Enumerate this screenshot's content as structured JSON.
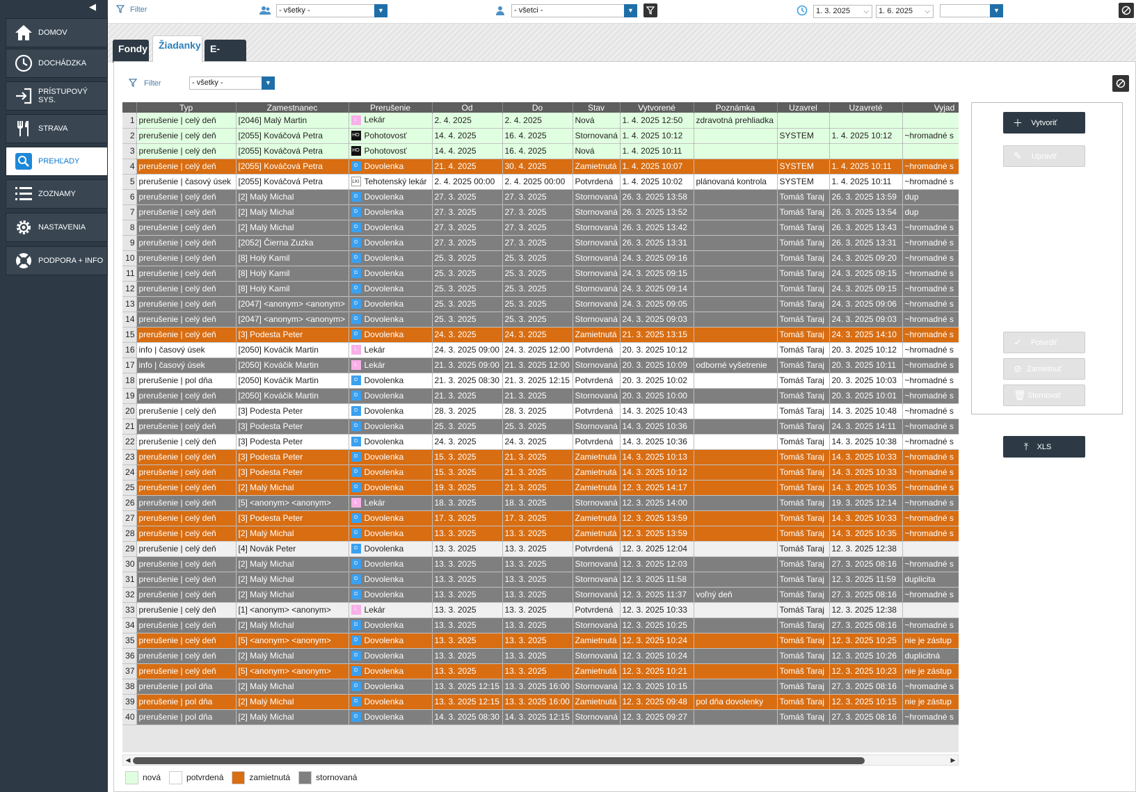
{
  "sidebar": {
    "items": [
      {
        "label": "DOMOV",
        "icon": "home-icon"
      },
      {
        "label": "DOCHÁDZKA",
        "icon": "clock-icon"
      },
      {
        "label": "PRÍSTUPOVÝ SYS.",
        "icon": "login-icon"
      },
      {
        "label": "STRAVA",
        "icon": "cutlery-icon"
      },
      {
        "label": "PREHĽADY",
        "icon": "search-icon",
        "active": true
      },
      {
        "label": "ZOZNAMY",
        "icon": "list-icon"
      },
      {
        "label": "NASTAVENIA",
        "icon": "gear-icon"
      },
      {
        "label": "PODPORA + INFO",
        "icon": "lifebuoy-icon"
      }
    ]
  },
  "topbar": {
    "filter_label": "Filter",
    "group_value": "- všetky -",
    "person_value": "- všetci -",
    "date_from": "1. 3. 2025",
    "date_to": "1. 6. 2025",
    "period_value": ""
  },
  "tabs": [
    {
      "label": "Fondy"
    },
    {
      "label": "Žiadanky",
      "active": true
    },
    {
      "label": "E-maily"
    }
  ],
  "content": {
    "filter_label": "Filter",
    "filter_value": "- všetky -"
  },
  "grid": {
    "columns": [
      "Typ",
      "Zamestnanec",
      "Prerušenie",
      "Od",
      "Do",
      "Stav",
      "Vytvorené",
      "Poznámka",
      "Uzavrel",
      "Uzavreté",
      "Vyjad"
    ],
    "rows": [
      [
        "nova",
        "prerušenie | celý deň",
        "[2046] Malý Martin",
        "L",
        "Lekár",
        "2. 4. 2025",
        "2. 4. 2025",
        "Nová",
        "1. 4. 2025  12:50",
        "zdravotná prehliadka",
        "",
        "",
        " "
      ],
      [
        "nova",
        "prerušenie | celý deň",
        "[2055] Kováčová Petra",
        "HO",
        "Pohotovosť",
        "14. 4. 2025",
        "16. 4. 2025",
        "Stornovaná",
        "1. 4. 2025  10:12",
        "",
        "SYSTEM",
        "1. 4. 2025  10:12",
        "~hromadné s"
      ],
      [
        "nova",
        "prerušenie | celý deň",
        "[2055] Kováčová Petra",
        "HO",
        "Pohotovosť",
        "14. 4. 2025",
        "16. 4. 2025",
        "Nová",
        "1. 4. 2025  10:11",
        "",
        "",
        "",
        ""
      ],
      [
        "zamietnuta",
        "prerušenie | celý deň",
        "[2055] Kováčová Petra",
        "D",
        "Dovolenka",
        "21. 4. 2025",
        "30. 4. 2025",
        "Zamietnutá",
        "1. 4. 2025  10:07",
        "",
        "SYSTEM",
        "1. 4. 2025  10:11",
        "~hromadné s"
      ],
      [
        "potvrdena",
        "prerušenie | časový úsek",
        "[2055] Kováčová Petra",
        "LKI",
        "Tehotenský lekár",
        "2. 4. 2025 00:00",
        "2. 4. 2025 00:00",
        "Potvrdená",
        "1. 4. 2025  10:02",
        "plánovaná kontrola",
        "SYSTEM",
        "1. 4. 2025  10:11",
        "~hromadné s"
      ],
      [
        "stornovana",
        "prerušenie | celý deň",
        "[2] Malý Michal",
        "D",
        "Dovolenka",
        "27. 3. 2025",
        "27. 3. 2025",
        "Stornovaná",
        "26. 3. 2025  13:58",
        "",
        "Tomáš Taraj",
        "26. 3. 2025  13:59",
        "dup"
      ],
      [
        "stornovana",
        "prerušenie | celý deň",
        "[2] Malý Michal",
        "D",
        "Dovolenka",
        "27. 3. 2025",
        "27. 3. 2025",
        "Stornovaná",
        "26. 3. 2025  13:52",
        "",
        "Tomáš Taraj",
        "26. 3. 2025  13:54",
        "dup"
      ],
      [
        "stornovana",
        "prerušenie | celý deň",
        "[2] Malý Michal",
        "D",
        "Dovolenka",
        "27. 3. 2025",
        "27. 3. 2025",
        "Stornovaná",
        "26. 3. 2025  13:42",
        "",
        "Tomáš Taraj",
        "26. 3. 2025  13:43",
        "~hromadné s"
      ],
      [
        "stornovana",
        "prerušenie | celý deň",
        "[2052] Čierna Zuzka",
        "D",
        "Dovolenka",
        "27. 3. 2025",
        "27. 3. 2025",
        "Stornovaná",
        "26. 3. 2025  13:31",
        "",
        "Tomáš Taraj",
        "26. 3. 2025  13:31",
        "~hromadné s"
      ],
      [
        "stornovana",
        "prerušenie | celý deň",
        "[8] Holý Kamil",
        "D",
        "Dovolenka",
        "25. 3. 2025",
        "25. 3. 2025",
        "Stornovaná",
        "24. 3. 2025  09:16",
        "",
        "Tomáš Taraj",
        "24. 3. 2025  09:20",
        "~hromadné s"
      ],
      [
        "stornovana",
        "prerušenie | celý deň",
        "[8] Holý Kamil",
        "D",
        "Dovolenka",
        "25. 3. 2025",
        "25. 3. 2025",
        "Stornovaná",
        "24. 3. 2025  09:15",
        "",
        "Tomáš Taraj",
        "24. 3. 2025  09:15",
        "~hromadné s"
      ],
      [
        "stornovana",
        "prerušenie | celý deň",
        "[8] Holý Kamil",
        "D",
        "Dovolenka",
        "25. 3. 2025",
        "25. 3. 2025",
        "Stornovaná",
        "24. 3. 2025  09:14",
        "",
        "Tomáš Taraj",
        "24. 3. 2025  09:15",
        "~hromadné s"
      ],
      [
        "stornovana",
        "prerušenie | celý deň",
        "[2047] <anonym> <anonym>",
        "D",
        "Dovolenka",
        "25. 3. 2025",
        "25. 3. 2025",
        "Stornovaná",
        "24. 3. 2025  09:05",
        "",
        "Tomáš Taraj",
        "24. 3. 2025  09:06",
        "~hromadné s"
      ],
      [
        "stornovana",
        "prerušenie | celý deň",
        "[2047] <anonym> <anonym>",
        "D",
        "Dovolenka",
        "25. 3. 2025",
        "25. 3. 2025",
        "Stornovaná",
        "24. 3. 2025  09:03",
        "",
        "Tomáš Taraj",
        "24. 3. 2025  09:03",
        "~hromadné s"
      ],
      [
        "zamietnuta",
        "prerušenie | celý deň",
        "[3] Podesta Peter",
        "D",
        "Dovolenka",
        "24. 3. 2025",
        "24. 3. 2025",
        "Zamietnutá",
        "21. 3. 2025  13:15",
        "",
        "Tomáš Taraj",
        "24. 3. 2025  14:10",
        "~hromadné s"
      ],
      [
        "potvrdena",
        "info | časový úsek",
        "[2050] Kováčik Martin",
        "L",
        "Lekár",
        "24. 3. 2025 09:00",
        "24. 3. 2025 12:00",
        "Potvrdená",
        "20. 3. 2025  10:12",
        "",
        "Tomáš Taraj",
        "20. 3. 2025  10:12",
        "~hromadné s"
      ],
      [
        "stornovana",
        "info | časový úsek",
        "[2050] Kováčik Martin",
        "L",
        "Lekár",
        "21. 3. 2025 09:00",
        "21. 3. 2025 12:00",
        "Stornovaná",
        "20. 3. 2025  10:09",
        "odborné vyšetrenie",
        "Tomáš Taraj",
        "20. 3. 2025  10:11",
        "~hromadné s"
      ],
      [
        "potvrdena",
        "prerušenie | pol dňa",
        "[2050] Kováčik Martin",
        "D",
        "Dovolenka",
        "21. 3. 2025 08:30",
        "21. 3. 2025 12:15",
        "Potvrdená",
        "20. 3. 2025  10:02",
        "",
        "Tomáš Taraj",
        "20. 3. 2025  10:03",
        "~hromadné s"
      ],
      [
        "stornovana",
        "prerušenie | celý deň",
        "[2050] Kováčik Martin",
        "D",
        "Dovolenka",
        "21. 3. 2025",
        "21. 3. 2025",
        "Stornovaná",
        "20. 3. 2025  10:00",
        "",
        "Tomáš Taraj",
        "20. 3. 2025  10:01",
        "~hromadné s"
      ],
      [
        "potvrdena",
        "prerušenie | celý deň",
        "[3] Podesta Peter",
        "D",
        "Dovolenka",
        "28. 3. 2025",
        "28. 3. 2025",
        "Potvrdená",
        "14. 3. 2025  10:43",
        "",
        "Tomáš Taraj",
        "14. 3. 2025  10:48",
        "~hromadné s"
      ],
      [
        "stornovana",
        "prerušenie | celý deň",
        "[3] Podesta Peter",
        "D",
        "Dovolenka",
        "25. 3. 2025",
        "25. 3. 2025",
        "Stornovaná",
        "14. 3. 2025  10:36",
        "",
        "Tomáš Taraj",
        "24. 3. 2025  14:11",
        "~hromadné s"
      ],
      [
        "potvrdena",
        "prerušenie | celý deň",
        "[3] Podesta Peter",
        "D",
        "Dovolenka",
        "24. 3. 2025",
        "24. 3. 2025",
        "Potvrdená",
        "14. 3. 2025  10:36",
        "",
        "Tomáš Taraj",
        "14. 3. 2025  10:38",
        "~hromadné s"
      ],
      [
        "zamietnuta",
        "prerušenie | celý deň",
        "[3] Podesta Peter",
        "D",
        "Dovolenka",
        "15. 3. 2025",
        "21. 3. 2025",
        "Zamietnutá",
        "14. 3. 2025  10:13",
        "",
        "Tomáš Taraj",
        "14. 3. 2025  10:33",
        "~hromadné s"
      ],
      [
        "zamietnuta",
        "prerušenie | celý deň",
        "[3] Podesta Peter",
        "D",
        "Dovolenka",
        "15. 3. 2025",
        "21. 3. 2025",
        "Zamietnutá",
        "14. 3. 2025  10:12",
        "",
        "Tomáš Taraj",
        "14. 3. 2025  10:33",
        "~hromadné s"
      ],
      [
        "zamietnuta",
        "prerušenie | celý deň",
        "[2] Malý Michal",
        "D",
        "Dovolenka",
        "19. 3. 2025",
        "21. 3. 2025",
        "Zamietnutá",
        "12. 3. 2025  14:17",
        "",
        "Tomáš Taraj",
        "14. 3. 2025  10:35",
        "~hromadné s"
      ],
      [
        "stornovana",
        "prerušenie | celý deň",
        "[5] <anonym> <anonym>",
        "L",
        "Lekár",
        "18. 3. 2025",
        "18. 3. 2025",
        "Stornovaná",
        "12. 3. 2025  14:00",
        "",
        "Tomáš Taraj",
        "19. 3. 2025  12:14",
        "~hromadné s"
      ],
      [
        "zamietnuta",
        "prerušenie | celý deň",
        "[3] Podesta Peter",
        "D",
        "Dovolenka",
        "17. 3. 2025",
        "17. 3. 2025",
        "Zamietnutá",
        "12. 3. 2025  13:59",
        "",
        "Tomáš Taraj",
        "14. 3. 2025  10:33",
        "~hromadné s"
      ],
      [
        "zamietnuta",
        "prerušenie | celý deň",
        "[2] Malý Michal",
        "D",
        "Dovolenka",
        "13. 3. 2025",
        "13. 3. 2025",
        "Zamietnutá",
        "12. 3. 2025  13:59",
        "",
        "Tomáš Taraj",
        "14. 3. 2025  10:35",
        "~hromadné s"
      ],
      [
        "potvrdena alt",
        "prerušenie | celý deň",
        "[4] Novák Peter",
        "D",
        "Dovolenka",
        "13. 3. 2025",
        "13. 3. 2025",
        "Potvrdená",
        "12. 3. 2025  12:04",
        "",
        "Tomáš Taraj",
        "12. 3. 2025  12:38",
        ""
      ],
      [
        "stornovana",
        "prerušenie | celý deň",
        "[2] Malý Michal",
        "D",
        "Dovolenka",
        "13. 3. 2025",
        "13. 3. 2025",
        "Stornovaná",
        "12. 3. 2025  12:03",
        "",
        "Tomáš Taraj",
        "27. 3. 2025  08:16",
        "~hromadné s"
      ],
      [
        "stornovana",
        "prerušenie | celý deň",
        "[2] Malý Michal",
        "D",
        "Dovolenka",
        "13. 3. 2025",
        "13. 3. 2025",
        "Stornovaná",
        "12. 3. 2025  11:58",
        "",
        "Tomáš Taraj",
        "12. 3. 2025  11:59",
        "duplicita"
      ],
      [
        "stornovana",
        "prerušenie | celý deň",
        "[2] Malý Michal",
        "D",
        "Dovolenka",
        "13. 3. 2025",
        "13. 3. 2025",
        "Stornovaná",
        "12. 3. 2025  11:37",
        "voľný deň",
        "Tomáš Taraj",
        "27. 3. 2025  08:16",
        "~hromadné s"
      ],
      [
        "potvrdena alt",
        "prerušenie | celý deň",
        "[1] <anonym> <anonym>",
        "L",
        "Lekár",
        "13. 3. 2025",
        "13. 3. 2025",
        "Potvrdená",
        "12. 3. 2025  10:33",
        "",
        "Tomáš Taraj",
        "12. 3. 2025  12:38",
        ""
      ],
      [
        "stornovana",
        "prerušenie | celý deň",
        "[2] Malý Michal",
        "D",
        "Dovolenka",
        "13. 3. 2025",
        "13. 3. 2025",
        "Stornovaná",
        "12. 3. 2025  10:25",
        "",
        "Tomáš Taraj",
        "27. 3. 2025  08:16",
        "~hromadné s"
      ],
      [
        "zamietnuta",
        "prerušenie | celý deň",
        "[5] <anonym> <anonym>",
        "D",
        "Dovolenka",
        "13. 3. 2025",
        "13. 3. 2025",
        "Zamietnutá",
        "12. 3. 2025  10:24",
        "",
        "Tomáš Taraj",
        "12. 3. 2025  10:25",
        "nie je zástup"
      ],
      [
        "stornovana",
        "prerušenie | celý deň",
        "[2] Malý Michal",
        "D",
        "Dovolenka",
        "13. 3. 2025",
        "13. 3. 2025",
        "Stornovaná",
        "12. 3. 2025  10:24",
        "",
        "Tomáš Taraj",
        "12. 3. 2025  10:26",
        "duplicitná"
      ],
      [
        "zamietnuta",
        "prerušenie | celý deň",
        "[5] <anonym> <anonym>",
        "D",
        "Dovolenka",
        "13. 3. 2025",
        "13. 3. 2025",
        "Zamietnutá",
        "12. 3. 2025  10:21",
        "",
        "Tomáš Taraj",
        "12. 3. 2025  10:23",
        "nie je zástup"
      ],
      [
        "stornovana",
        "prerušenie | pol dňa",
        "[2] Malý Michal",
        "D",
        "Dovolenka",
        "13. 3. 2025 12:15",
        "13. 3. 2025 16:00",
        "Stornovaná",
        "12. 3. 2025  10:15",
        "",
        "Tomáš Taraj",
        "27. 3. 2025  08:16",
        "~hromadné s"
      ],
      [
        "zamietnuta",
        "prerušenie | pol dňa",
        "[2] Malý Michal",
        "D",
        "Dovolenka",
        "13. 3. 2025 12:15",
        "13. 3. 2025 16:00",
        "Zamietnutá",
        "12. 3. 2025  09:48",
        "pol dňa dovolenky",
        "Tomáš Taraj",
        "12. 3. 2025  10:15",
        "nie je zástup"
      ],
      [
        "stornovana",
        "prerušenie | pol dňa",
        "[2] Malý Michal",
        "D",
        "Dovolenka",
        "14. 3. 2025 08:30",
        "14. 3. 2025 12:15",
        "Stornovaná",
        "12. 3. 2025  09:27",
        "",
        "Tomáš Taraj",
        "27. 3. 2025  08:16",
        "~hromadné s"
      ]
    ]
  },
  "actions": {
    "create": "Vytvoriť",
    "edit": "Upraviť",
    "confirm": "Potvrdiť",
    "reject": "Zamietnuť",
    "cancel": "Stornovať",
    "export": "XLS"
  },
  "legend": [
    {
      "label": "nová",
      "color": "#e0ffe0"
    },
    {
      "label": "potvrdená",
      "color": "#ffffff"
    },
    {
      "label": "zamietnutá",
      "color": "#d86d12"
    },
    {
      "label": "stornovaná",
      "color": "#7f7f7f"
    }
  ]
}
